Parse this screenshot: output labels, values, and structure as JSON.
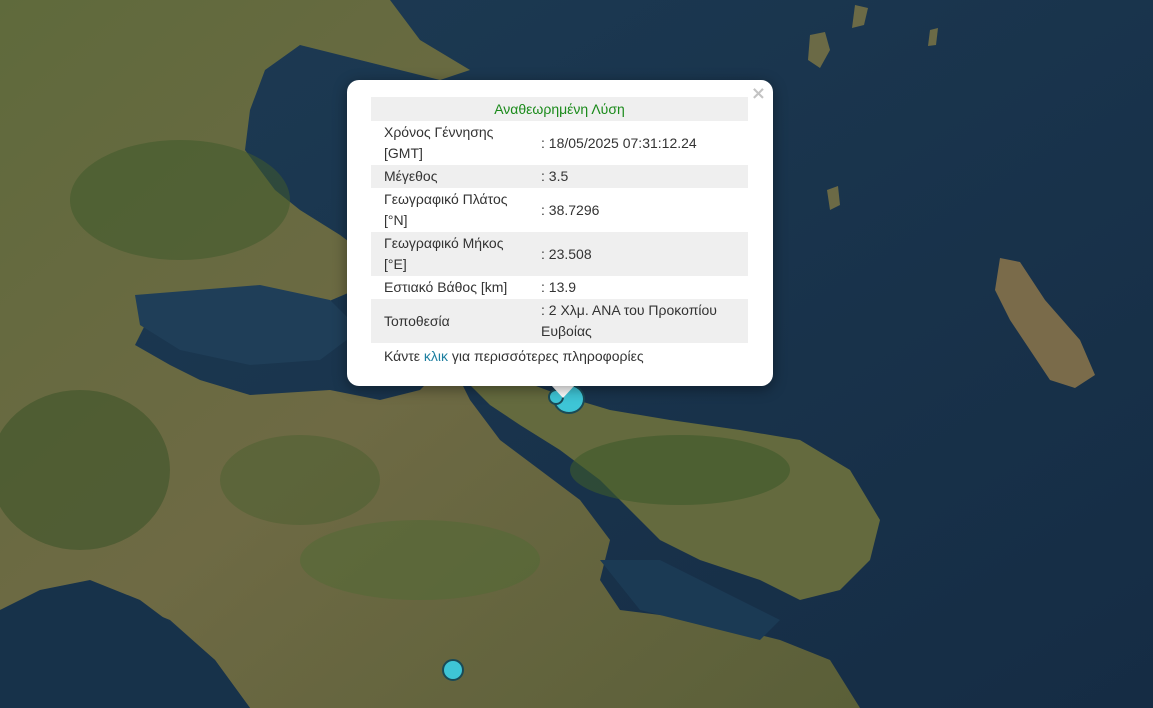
{
  "popup": {
    "close_symbol": "×",
    "header": "Αναθεωρημένη Λύση",
    "rows": [
      {
        "label": "Χρόνος Γέννησης [GMT]",
        "value": ": 18/05/2025 07:31:12.24"
      },
      {
        "label": "Μέγεθος",
        "value": ": 3.5"
      },
      {
        "label": "Γεωγραφικό Πλάτος [°N]",
        "value": ": 38.7296"
      },
      {
        "label": "Γεωγραφικό Μήκος [°E]",
        "value": ": 23.508"
      },
      {
        "label": "Εστιακό Βάθος [km]",
        "value": ": 13.9"
      },
      {
        "label": "Τοποθεσία",
        "value": ": 2 Χλμ. ΑΝΑ του Προκοπίου Ευβοίας"
      }
    ],
    "footer": {
      "prefix": "Κάντε ",
      "link": "κλικ",
      "suffix": " για περισσότερες πληροφορίες"
    }
  },
  "colors": {
    "marker_fill": "#3ec5d6",
    "marker_stroke": "#1a4a56",
    "header_text": "#1a8a1a",
    "link": "#1d7fa0"
  }
}
